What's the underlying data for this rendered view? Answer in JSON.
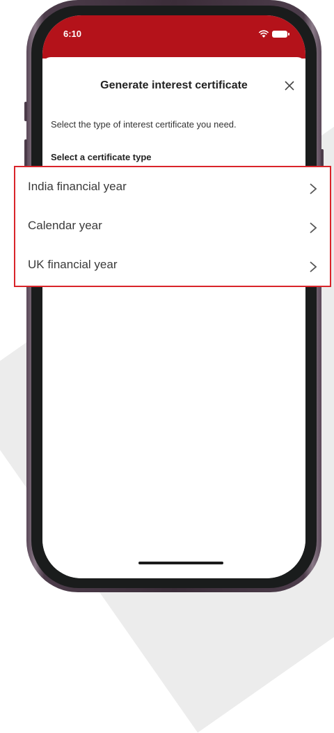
{
  "status": {
    "time": "6:10"
  },
  "sheet": {
    "title": "Generate interest certificate",
    "description": "Select the type of interest certificate you need.",
    "section_label": "Select a certificate type"
  },
  "options": [
    {
      "label": "India financial year",
      "icon": "chevron-right-icon"
    },
    {
      "label": "Calendar year",
      "icon": "chevron-right-icon"
    },
    {
      "label": "UK financial year",
      "icon": "chevron-right-icon"
    }
  ],
  "colors": {
    "header": "#b4121a",
    "highlight": "#d9242a",
    "phone_frame": "#3b2d39"
  }
}
